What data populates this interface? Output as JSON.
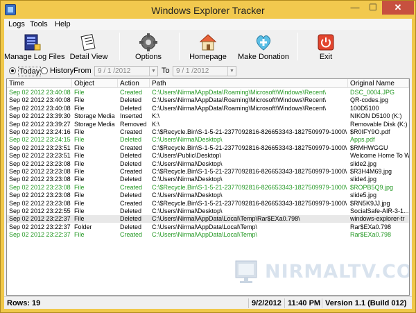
{
  "window": {
    "title": "Windows Explorer Tracker",
    "min_glyph": "—",
    "max_glyph": "☐",
    "close_glyph": "✕"
  },
  "menu": [
    "Logs",
    "Tools",
    "Help"
  ],
  "toolbar": {
    "buttons": [
      {
        "label": "Manage Log Files",
        "icon": "log-files-icon"
      },
      {
        "label": "Detail View",
        "icon": "detail-view-icon"
      },
      {
        "label": "Options",
        "icon": "options-icon"
      },
      {
        "label": "Homepage",
        "icon": "home-icon"
      },
      {
        "label": "Make Donation",
        "icon": "donation-icon"
      },
      {
        "label": "Exit",
        "icon": "exit-icon"
      }
    ]
  },
  "filter": {
    "today_label": "Today",
    "history_label": "History",
    "from_label": "From",
    "to_label": "To",
    "from_date": "9 / 1 /2012",
    "to_date": "9 / 1 /2012",
    "selected": "today"
  },
  "columns": [
    "Time",
    "Object",
    "Action",
    "Path",
    "Original Name"
  ],
  "rows": [
    {
      "time": "Sep 02 2012 23:40:08",
      "object": "File",
      "action": "Created",
      "path": "C:\\Users\\Nirmal\\AppData\\Roaming\\Microsoft\\Windows\\Recent\\",
      "name": "DSC_0004.JPG",
      "green": true
    },
    {
      "time": "Sep 02 2012 23:40:08",
      "object": "File",
      "action": "Deleted",
      "path": "C:\\Users\\Nirmal\\AppData\\Roaming\\Microsoft\\Windows\\Recent\\",
      "name": "QR-codes.jpg",
      "green": false
    },
    {
      "time": "Sep 02 2012 23:40:08",
      "object": "File",
      "action": "Deleted",
      "path": "C:\\Users\\Nirmal\\AppData\\Roaming\\Microsoft\\Windows\\Recent\\",
      "name": "100D5100",
      "green": false
    },
    {
      "time": "Sep 02 2012 23:39:30",
      "object": "Storage Media",
      "action": "Inserted",
      "path": "K:\\",
      "name": "NIKON D5100 (K:)",
      "green": false
    },
    {
      "time": "Sep 02 2012 23:39:27",
      "object": "Storage Media",
      "action": "Removed",
      "path": "K:\\",
      "name": "Removable Disk (K:)",
      "green": false
    },
    {
      "time": "Sep 02 2012 23:24:16",
      "object": "File",
      "action": "Created",
      "path": "C:\\$Recycle.Bin\\S-1-5-21-2377092816-826653343-1827509979-1000\\",
      "name": "$R0IFY9O.pdf",
      "green": false
    },
    {
      "time": "Sep 02 2012 23:24:15",
      "object": "File",
      "action": "Deleted",
      "path": "C:\\Users\\Nirmal\\Desktop\\",
      "name": "Apps.pdf",
      "green": true
    },
    {
      "time": "Sep 02 2012 23:23:51",
      "object": "File",
      "action": "Created",
      "path": "C:\\$Recycle.Bin\\S-1-5-21-2377092816-826653343-1827509979-1000\\",
      "name": "$RMHWGGU",
      "green": false
    },
    {
      "time": "Sep 02 2012 23:23:51",
      "object": "File",
      "action": "Deleted",
      "path": "C:\\Users\\Public\\Desktop\\",
      "name": "Welcome Home To W",
      "green": false
    },
    {
      "time": "Sep 02 2012 23:23:08",
      "object": "File",
      "action": "Deleted",
      "path": "C:\\Users\\Nirmal\\Desktop\\",
      "name": "slide2.jpg",
      "green": false
    },
    {
      "time": "Sep 02 2012 23:23:08",
      "object": "File",
      "action": "Created",
      "path": "C:\\$Recycle.Bin\\S-1-5-21-2377092816-826653343-1827509979-1000\\",
      "name": "$R3H4M69.jpg",
      "green": false
    },
    {
      "time": "Sep 02 2012 23:23:08",
      "object": "File",
      "action": "Deleted",
      "path": "C:\\Users\\Nirmal\\Desktop\\",
      "name": "slide4.jpg",
      "green": false
    },
    {
      "time": "Sep 02 2012 23:23:08",
      "object": "File",
      "action": "Created",
      "path": "C:\\$Recycle.Bin\\S-1-5-21-2377092816-826653343-1827509979-1000\\",
      "name": "$ROPB5Q9.jpg",
      "green": true
    },
    {
      "time": "Sep 02 2012 23:23:08",
      "object": "File",
      "action": "Deleted",
      "path": "C:\\Users\\Nirmal\\Desktop\\",
      "name": "slide5.jpg",
      "green": false
    },
    {
      "time": "Sep 02 2012 23:23:08",
      "object": "File",
      "action": "Created",
      "path": "C:\\$Recycle.Bin\\S-1-5-21-2377092816-826653343-1827509979-1000\\",
      "name": "$RN5K9JJ.jpg",
      "green": false
    },
    {
      "time": "Sep 02 2012 23:22:55",
      "object": "File",
      "action": "Deleted",
      "path": "C:\\Users\\Nirmal\\Desktop\\",
      "name": "SocialSafe-AIR-3-1...",
      "green": false
    },
    {
      "time": "Sep 02 2012 23:22:37",
      "object": "File",
      "action": "Deleted",
      "path": "C:\\Users\\Nirmal\\AppData\\Local\\Temp\\Rar$EXa0.798\\",
      "name": "windows-explorer-tr",
      "green": false,
      "selected": true
    },
    {
      "time": "Sep 02 2012 23:22:37",
      "object": "Folder",
      "action": "Deleted",
      "path": "C:\\Users\\Nirmal\\AppData\\Local\\Temp\\",
      "name": "Rar$EXa0.798",
      "green": false
    },
    {
      "time": "Sep 02 2012 23:22:37",
      "object": "File",
      "action": "Created",
      "path": "C:\\Users\\Nirmal\\AppData\\Local\\Temp\\",
      "name": "Rar$EXa0.798",
      "green": true
    }
  ],
  "watermark": "NIRMALTV.COM",
  "status": {
    "rows": "Rows: 19",
    "date": "9/2/2012",
    "time": "11:40 PM",
    "version": "Version 1.1 (Build 012)"
  },
  "colors": {
    "green_text": "#239823",
    "title_bar": "#f2c94e",
    "close_button": "#c7503f"
  }
}
